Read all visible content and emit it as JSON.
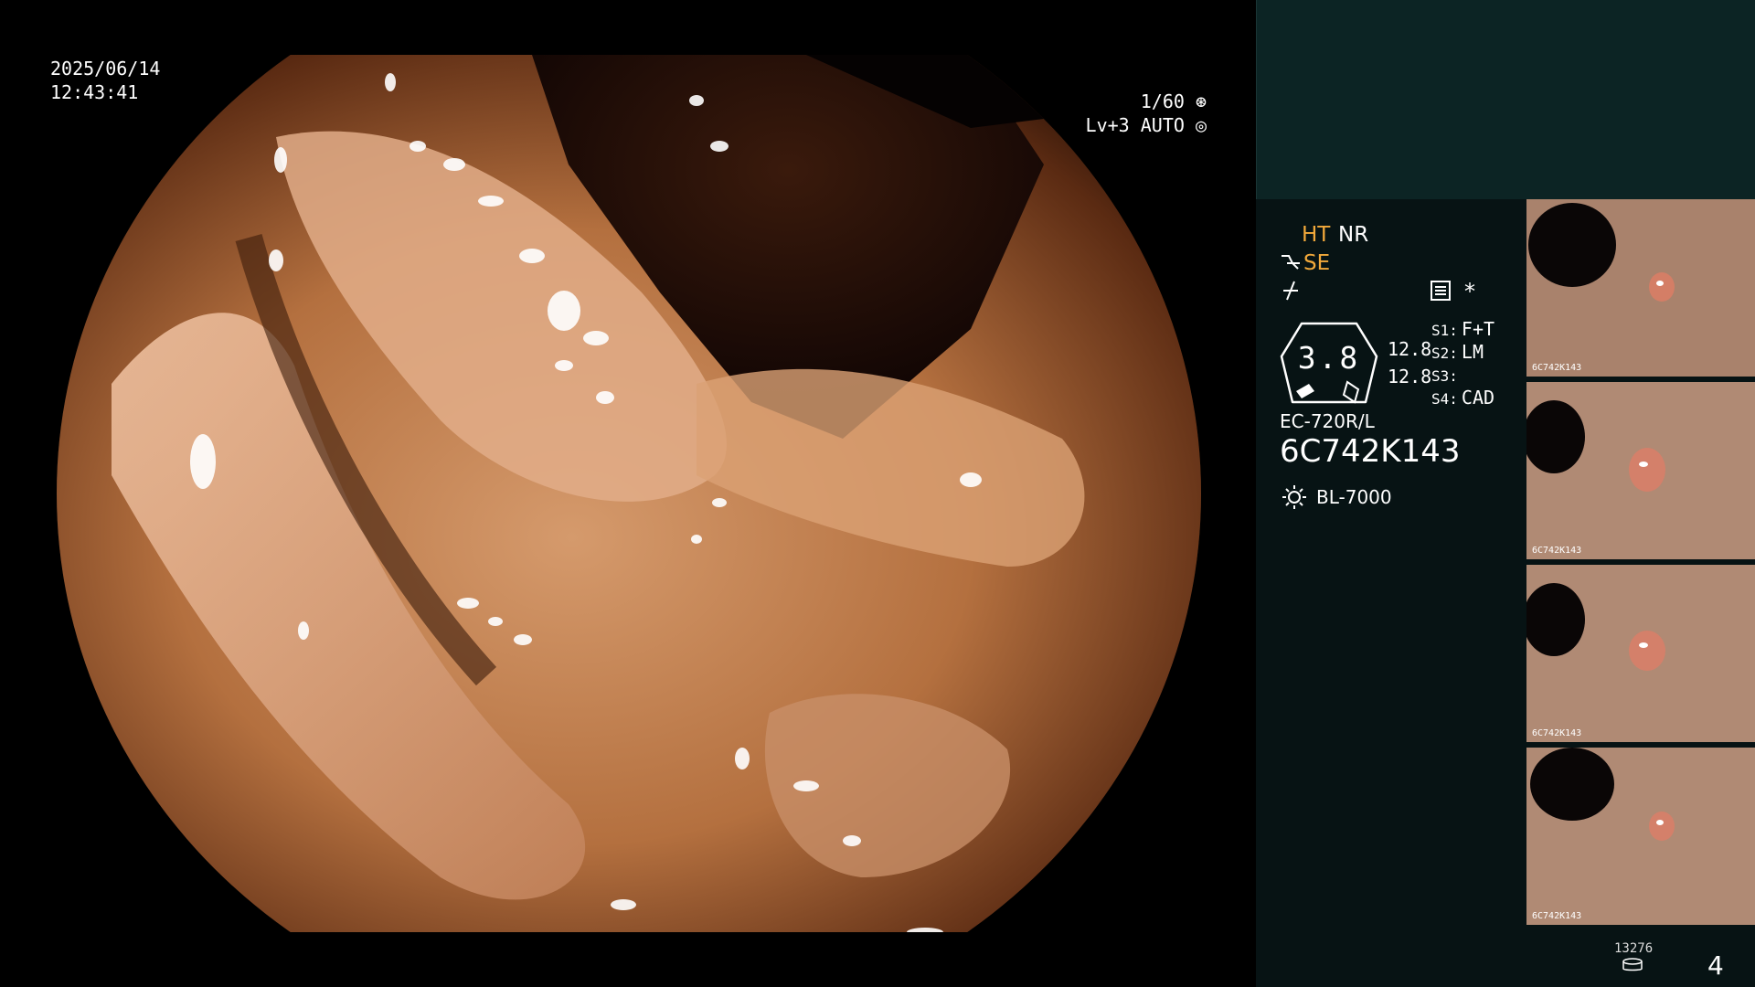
{
  "overlay": {
    "date": "2025/06/14",
    "time": "12:43:41",
    "shutter": "1/60",
    "iris": "Lv+3 AUTO"
  },
  "panel": {
    "ht": "HT",
    "nr": "NR",
    "se": "SE",
    "star": "*",
    "zoom_value": "3.8",
    "zoom_a": "12.8",
    "zoom_b": "12.8",
    "switches": [
      {
        "key": "S1:",
        "value": "F+T"
      },
      {
        "key": "S2:",
        "value": "LM"
      },
      {
        "key": "S3:",
        "value": ""
      },
      {
        "key": "S4:",
        "value": "CAD"
      }
    ],
    "scope_model": "EC-720R/L",
    "scope_serial": "6C742K143",
    "light_source": "BL-7000"
  },
  "thumbnails": [
    {
      "label": "6C742K143"
    },
    {
      "label": "6C742K143"
    },
    {
      "label": "6C742K143"
    },
    {
      "label": "6C742K143"
    }
  ],
  "footer": {
    "image_count": "13276",
    "page": "4"
  },
  "colors": {
    "panel_bg": "#071314",
    "panel_top_bg": "#0c2424",
    "accent_amber": "#f2a93b"
  }
}
